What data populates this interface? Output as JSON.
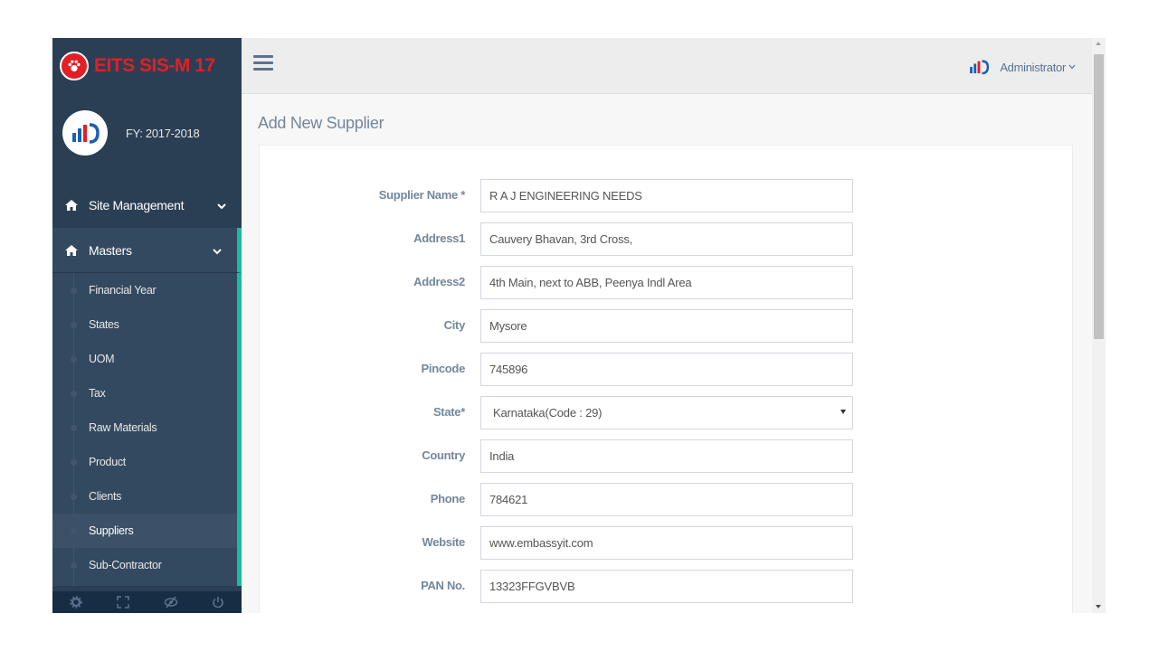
{
  "brand": {
    "title": "EITS SIS-M 17"
  },
  "profile": {
    "fy": "FY: 2017-2018"
  },
  "sidebar": {
    "site_management": "Site Management",
    "masters": "Masters",
    "sub_items": [
      "Financial Year",
      "States",
      "UOM",
      "Tax",
      "Raw Materials",
      "Product",
      "Clients",
      "Suppliers",
      "Sub-Contractor"
    ],
    "current": "Suppliers"
  },
  "user": {
    "name": "Administrator"
  },
  "page": {
    "title": "Add New Supplier"
  },
  "form": {
    "supplier_name": {
      "label": "Supplier Name *",
      "value": "R A J ENGINEERING NEEDS"
    },
    "address1": {
      "label": "Address1",
      "value": "Cauvery Bhavan, 3rd Cross,"
    },
    "address2": {
      "label": "Address2",
      "value": "4th Main, next to ABB, Peenya Indl Area"
    },
    "city": {
      "label": "City",
      "value": "Mysore"
    },
    "pincode": {
      "label": "Pincode",
      "value": "745896"
    },
    "state": {
      "label": "State*",
      "value": "Karnataka(Code : 29)"
    },
    "country": {
      "label": "Country",
      "value": "India"
    },
    "phone": {
      "label": "Phone",
      "value": "784621"
    },
    "website": {
      "label": "Website",
      "value": "www.embassyit.com"
    },
    "pan": {
      "label": "PAN No.",
      "value": "13323FFGVBVB"
    }
  },
  "colors": {
    "sidebar_bg": "#2a3f54",
    "accent": "#1abb9c",
    "brand_red": "#e31e24"
  },
  "icons": [
    "paw-icon",
    "eits-logo-icon",
    "home-icon",
    "chevron-down-icon",
    "gear-icon",
    "fullscreen-icon",
    "eye-slash-icon",
    "power-icon",
    "hamburger-icon"
  ]
}
